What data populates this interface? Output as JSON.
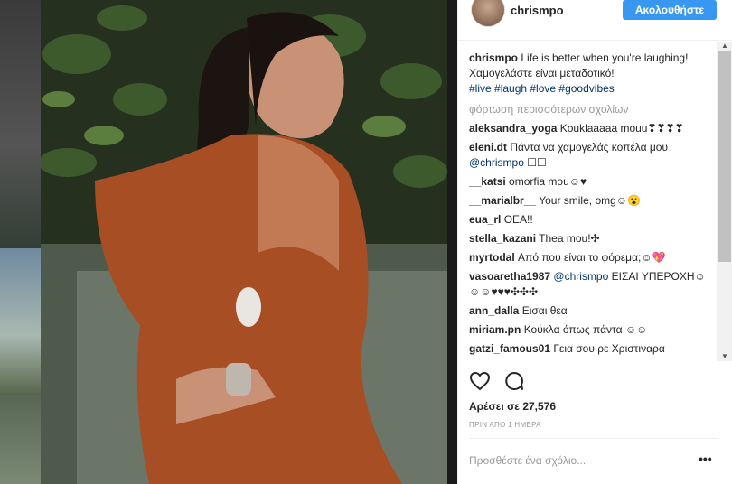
{
  "post": {
    "username": "chrismpo",
    "follow_label": "Ακολουθήστε"
  },
  "caption": {
    "user": "chrismpo",
    "text": "Life is better when you're laughing! Χαμογελάστε είναι μεταδοτικό!",
    "hashtags": "#live #laugh #love #goodvibes"
  },
  "load_more": "φόρτωση περισσότερων σχολίων",
  "comments": [
    {
      "user": "aleksandra_yoga",
      "text": "Kouklaaaaa mouu❣❣❣❣"
    },
    {
      "user": "eleni.dt",
      "text": "Πάντα να χαμογελάς κοπέλα μου",
      "mention": "@chrismpo",
      "after": " ☐☐"
    },
    {
      "user": "__katsi",
      "text": "omorfia mou☺♥"
    },
    {
      "user": "__marialbr__",
      "text": "Your smile, omg☺😮"
    },
    {
      "user": "eua_rl",
      "text": "ΘΕΑ!!"
    },
    {
      "user": "stella_kazani",
      "text": "Thea mou!✣"
    },
    {
      "user": "myrtodal",
      "text": "Από που είναι το φόρεμα;☺💖"
    },
    {
      "user": "vasoaretha1987",
      "mention": "@chrismpo",
      "text": "ΕΙΣΑΙ ΥΠΕΡΟΧΗ☺☺☺♥♥♥✣✣✣"
    },
    {
      "user": "ann_dalla",
      "text": "Εισαι θεα"
    },
    {
      "user": "miriam.pn",
      "text": "Κούκλα όπως πάντα ☺☺"
    },
    {
      "user": "gatzi_famous01",
      "text": "Γεια σου ρε Χριστιναρα"
    }
  ],
  "likes_text": "Αρέσει σε 27,576",
  "time_text": "ΠΡΙΝ ΑΠΟ 1 ΗΜΕΡΑ",
  "add_comment_placeholder": "Προσθέστε ένα σχόλιο...",
  "more_options": "•••",
  "icons": {
    "like": "heart-icon",
    "comment": "comment-bubble-icon",
    "options": "ellipsis-icon"
  },
  "colors": {
    "accent": "#3897f0",
    "hashtag": "#003569",
    "muted": "#999999"
  }
}
